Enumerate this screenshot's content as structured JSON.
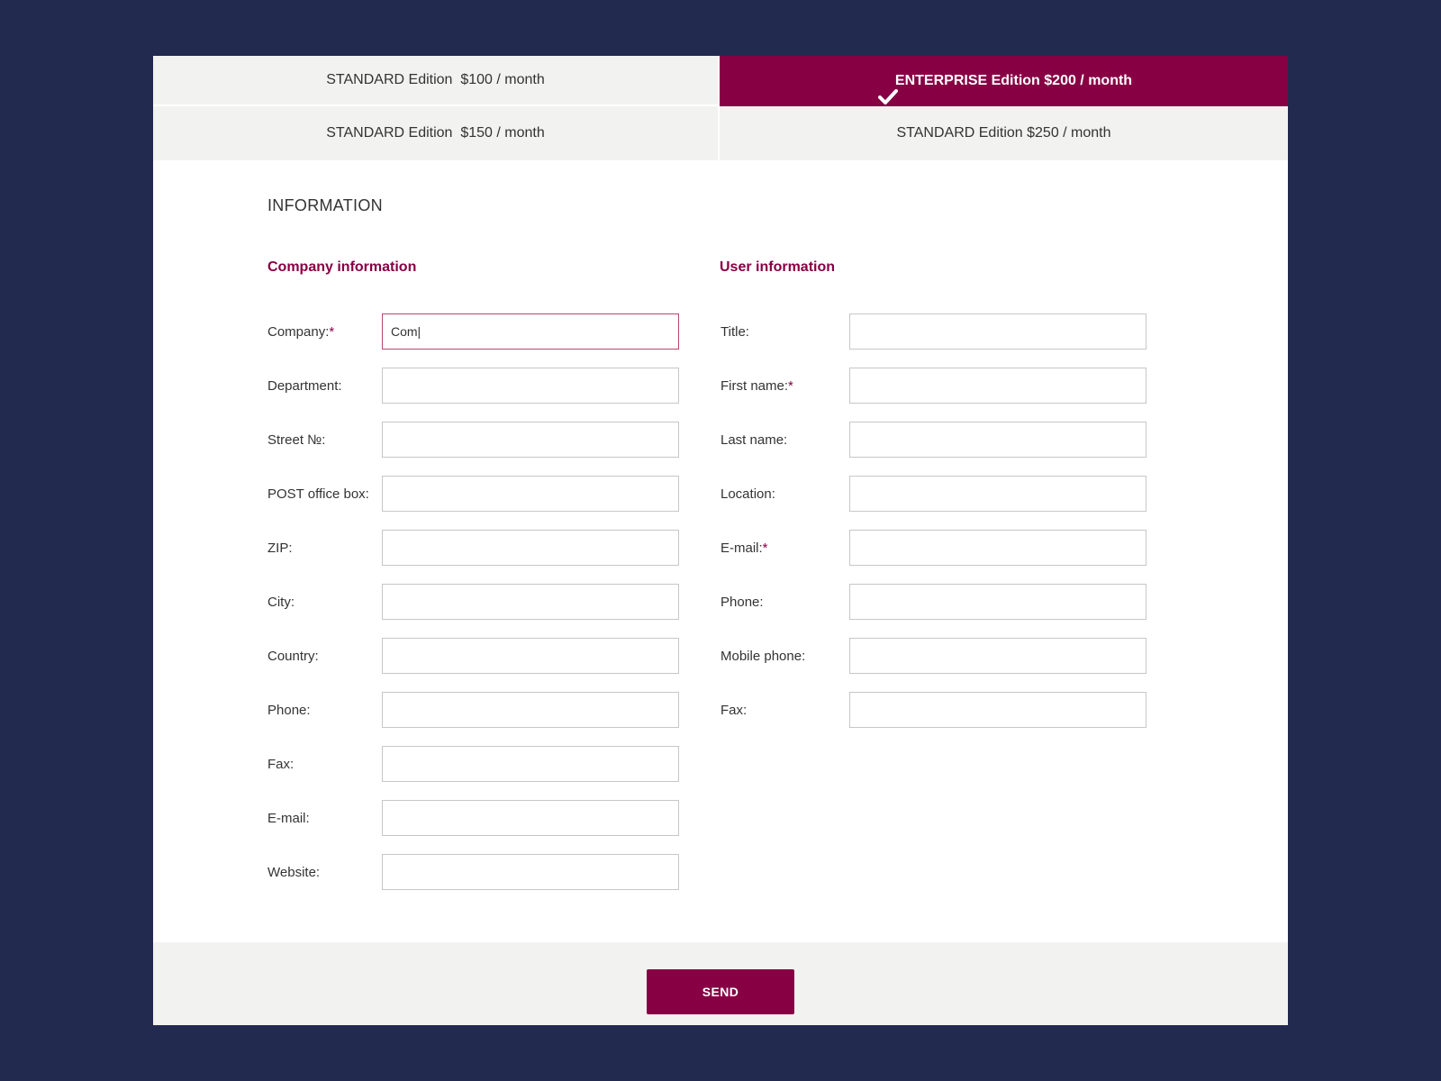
{
  "plans": [
    {
      "label": "STANDARD Edition  $100 / month",
      "selected": false
    },
    {
      "label": "ENTERPRISE Edition $200 / month",
      "selected": true
    },
    {
      "label": "STANDARD Edition  $150 / month",
      "selected": false
    },
    {
      "label": "STANDARD Edition $250 / month",
      "selected": false
    }
  ],
  "section_title": "INFORMATION",
  "company": {
    "title": "Company information",
    "fields": [
      {
        "label": "Company:",
        "required": "*",
        "value": "Com|"
      },
      {
        "label": "Department:",
        "required": "",
        "value": ""
      },
      {
        "label": "Street №:",
        "required": "",
        "value": ""
      },
      {
        "label": "POST office box:",
        "required": "",
        "value": ""
      },
      {
        "label": "ZIP:",
        "required": "",
        "value": ""
      },
      {
        "label": "City:",
        "required": "",
        "value": ""
      },
      {
        "label": "Country:",
        "required": "",
        "value": ""
      },
      {
        "label": "Phone:",
        "required": "",
        "value": ""
      },
      {
        "label": "Fax:",
        "required": "",
        "value": ""
      },
      {
        "label": "E-mail:",
        "required": "",
        "value": ""
      },
      {
        "label": "Website:",
        "required": "",
        "value": ""
      }
    ]
  },
  "user": {
    "title": "User information",
    "fields": [
      {
        "label": "Title:",
        "required": "",
        "value": ""
      },
      {
        "label": "First name:",
        "required": "*",
        "value": ""
      },
      {
        "label": "Last name:",
        "required": "",
        "value": ""
      },
      {
        "label": "Location:",
        "required": "",
        "value": ""
      },
      {
        "label": "E-mail:",
        "required": "*",
        "value": ""
      },
      {
        "label": "Phone:",
        "required": "",
        "value": ""
      },
      {
        "label": "Mobile phone:",
        "required": "",
        "value": ""
      },
      {
        "label": "Fax:",
        "required": "",
        "value": ""
      }
    ]
  },
  "footer": {
    "send_label": "SEND"
  },
  "colors": {
    "accent": "#870044",
    "background": "#222a50",
    "panel": "#f2f2f0"
  },
  "icons": {
    "selected_plan": "check-icon"
  }
}
